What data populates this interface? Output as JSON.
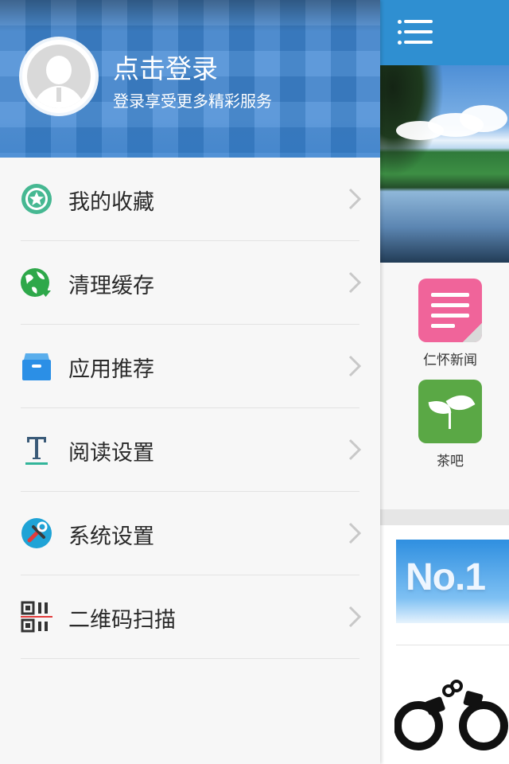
{
  "drawer": {
    "login_title": "点击登录",
    "login_subtitle": "登录享受更多精彩服务",
    "menu": [
      {
        "label": "我的收藏",
        "icon": "star-badge-icon"
      },
      {
        "label": "清理缓存",
        "icon": "globe-download-icon"
      },
      {
        "label": "应用推荐",
        "icon": "archive-box-icon"
      },
      {
        "label": "阅读设置",
        "icon": "text-t-icon"
      },
      {
        "label": "系统设置",
        "icon": "tools-icon"
      },
      {
        "label": "二维码扫描",
        "icon": "qr-scan-icon"
      }
    ]
  },
  "main": {
    "apps": [
      {
        "label": "仁怀新闻",
        "icon": "news-note-icon"
      },
      {
        "label": "茶吧",
        "icon": "tea-leaf-icon"
      }
    ],
    "promo_text": "No.1"
  },
  "colors": {
    "header_blue": "#3e86d3",
    "topbar_blue": "#2f8fd1",
    "news_pink": "#f0649a",
    "tea_green": "#5aa845"
  }
}
